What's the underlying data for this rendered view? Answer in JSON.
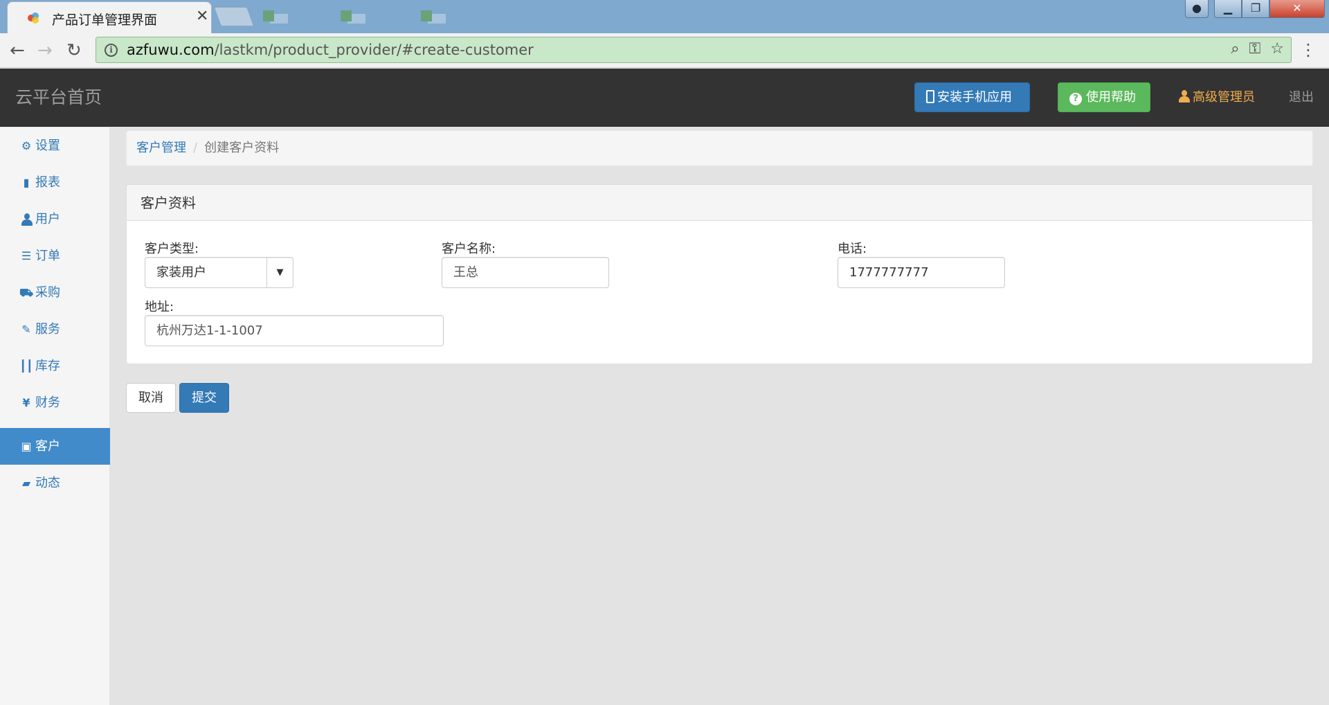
{
  "browser": {
    "tab_title": "产品订单管理界面",
    "url_host": "azfuwu.com",
    "url_path": "/lastkm/product_provider/#create-customer"
  },
  "header": {
    "brand": "云平台首页",
    "install_label": "安装手机应用",
    "help_label": "使用帮助",
    "user_label": "高级管理员",
    "logout_label": "退出"
  },
  "sidebar": {
    "items": [
      {
        "label": "设置",
        "icon": "gear-icon"
      },
      {
        "label": "报表",
        "icon": "bar-chart-icon"
      },
      {
        "label": "用户",
        "icon": "user-icon"
      },
      {
        "label": "订单",
        "icon": "list-icon"
      },
      {
        "label": "采购",
        "icon": "cart-icon"
      },
      {
        "label": "服务",
        "icon": "wrench-icon"
      },
      {
        "label": "库存",
        "icon": "barcode-icon"
      },
      {
        "label": "财务",
        "icon": "yen-icon"
      },
      {
        "label": "客户",
        "icon": "briefcase-icon"
      },
      {
        "label": "动态",
        "icon": "comment-icon"
      }
    ],
    "active_index": 8
  },
  "breadcrumb": {
    "parent": "客户管理",
    "separator": "/",
    "current": "创建客户资料"
  },
  "form": {
    "panel_title": "客户资料",
    "customer_type_label": "客户类型:",
    "customer_type_value": "家装用户",
    "customer_name_label": "客户名称:",
    "customer_name_value": "王总",
    "phone_label": "电话:",
    "phone_value": "1777777777",
    "address_label": "地址:",
    "address_value": "杭州万达1-1-1007"
  },
  "actions": {
    "cancel_label": "取消",
    "submit_label": "提交"
  },
  "colors": {
    "primary": "#337ab7",
    "success": "#5cb85c",
    "warning": "#f0ad4e",
    "navbar": "#333333",
    "sidebar_active": "#428bca"
  }
}
